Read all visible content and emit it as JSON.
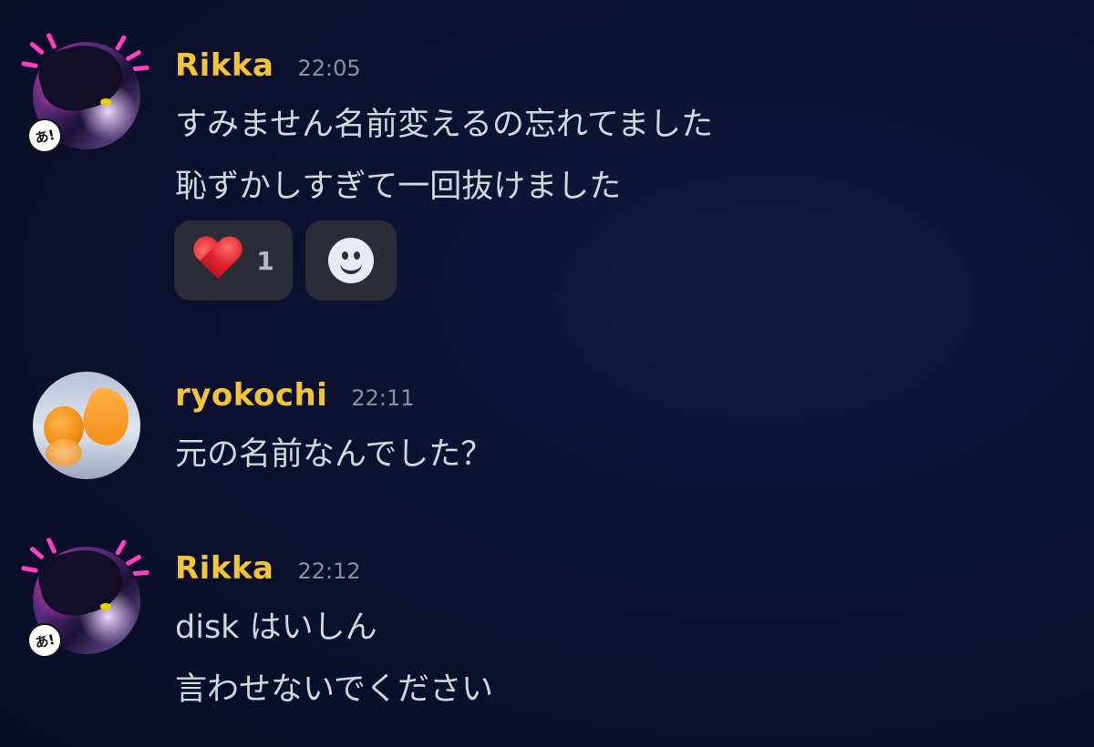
{
  "messages": [
    {
      "username": "Rikka",
      "time": "22:05",
      "avatar": "rikka-avatar",
      "badge": "あ!",
      "lines": [
        "すみません名前変えるの忘れてました",
        "恥ずかしすぎて一回抜けました"
      ],
      "reactions": [
        {
          "emoji": "heart-icon",
          "count": "1"
        },
        {
          "emoji": "add-reaction-icon"
        }
      ]
    },
    {
      "username": "ryokochi",
      "time": "22:11",
      "avatar": "ryokochi-avatar",
      "lines": [
        "元の名前なんでした？"
      ]
    },
    {
      "username": "Rikka",
      "time": "22:12",
      "avatar": "rikka-avatar",
      "badge": "あ!",
      "lines": [
        "disk はいしん",
        "言わせないでください"
      ]
    }
  ],
  "colors": {
    "background": "#0d1130",
    "username": "#f2c438",
    "timestamp": "#8e909c",
    "text": "#d4d6dd",
    "reaction_bg": "#2b2c36"
  }
}
